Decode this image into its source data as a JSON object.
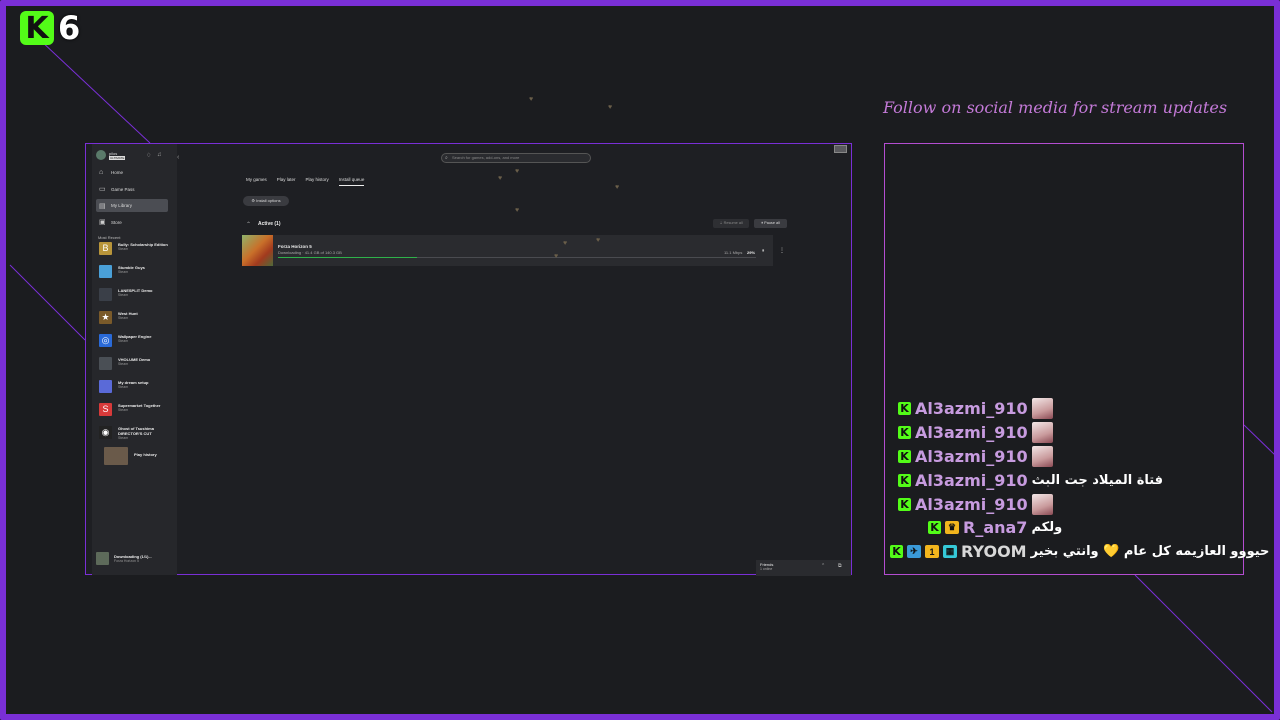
{
  "overlay": {
    "channel_logo": "K",
    "viewer_count": "6",
    "follow_text": "Follow on social media for stream updates",
    "chat": [
      {
        "user": "Al3azmi_910",
        "color": "#c79bdf",
        "text": "",
        "emote": true
      },
      {
        "user": "Al3azmi_910",
        "color": "#c79bdf",
        "text": "",
        "emote": true
      },
      {
        "user": "Al3azmi_910",
        "color": "#c79bdf",
        "text": "",
        "emote": true
      },
      {
        "user": "Al3azmi_910",
        "color": "#c79bdf",
        "text": "فتاة الميلاد جت البث",
        "emote": false
      },
      {
        "user": "Al3azmi_910",
        "color": "#c79bdf",
        "text": "",
        "emote": true
      },
      {
        "user": "R_ana7",
        "color": "#c79bdf",
        "text": "ولكم",
        "emote": false
      },
      {
        "user": "RYOOM",
        "color": "#d8d8d8",
        "text": "حيووو العازيمه كل عام 💛 وانتي بخير",
        "emote": false
      }
    ]
  },
  "app": {
    "profile_name": "pilos",
    "badge": "ULTIMATE",
    "search_placeholder": "Search for games, add-ons, and more",
    "nav": [
      {
        "label": "Home",
        "icon": "home-icon",
        "glyph": "⌂"
      },
      {
        "label": "Game Pass",
        "icon": "gamepass-icon",
        "glyph": "▭"
      },
      {
        "label": "My Library",
        "icon": "library-icon",
        "glyph": "▤",
        "selected": true
      },
      {
        "label": "Store",
        "icon": "store-icon",
        "glyph": "▣"
      }
    ],
    "most_recent_label": "Most Recent",
    "recent": [
      {
        "name": "Bully: Scholarship Edition",
        "source": "Steam",
        "color": "#b8953a",
        "glyph": "B"
      },
      {
        "name": "Stumble Guys",
        "source": "Steam",
        "color": "#4aa0d8",
        "glyph": ""
      },
      {
        "name": "LANESPLIT Demo",
        "source": "Steam",
        "color": "#3a3f48",
        "glyph": ""
      },
      {
        "name": "West Hunt",
        "source": "Steam",
        "color": "#7a5a2a",
        "glyph": "★"
      },
      {
        "name": "Wallpaper Engine",
        "source": "Steam",
        "color": "#2a6ad8",
        "glyph": "◎"
      },
      {
        "name": "VHOLUME Demo",
        "source": "Steam",
        "color": "#4a4f55",
        "glyph": ""
      },
      {
        "name": "My dream setup",
        "source": "Steam",
        "color": "#5a6ad8",
        "glyph": ""
      },
      {
        "name": "Supermarket Together",
        "source": "Steam",
        "color": "#d83a3a",
        "glyph": "S"
      },
      {
        "name": "Ghost of Tsushima DIRECTOR'S CUT",
        "source": "Steam",
        "color": "#222",
        "glyph": "◉"
      },
      {
        "name": "Play history",
        "source": "",
        "color": "#6a5a4a",
        "glyph": ""
      }
    ],
    "downloading_label": "Downloading (1/1)...",
    "downloading_game": "Forza Horizon 5",
    "tabs": [
      {
        "label": "My games"
      },
      {
        "label": "Play later"
      },
      {
        "label": "Play history"
      },
      {
        "label": "Install queue",
        "active": true
      }
    ],
    "install_options": "Install options",
    "active_label": "Active (1)",
    "resume_all": "Resume all",
    "pause_all": "Pause all",
    "download": {
      "name": "Forza Horizon 5",
      "status": "Downloading",
      "size": "41.4 GB of 140.3 GB",
      "speed": "11.1 Mbps",
      "percent": "29%",
      "progress": 0.29
    },
    "friends_title": "Friends",
    "friends_sub": "1 online"
  }
}
